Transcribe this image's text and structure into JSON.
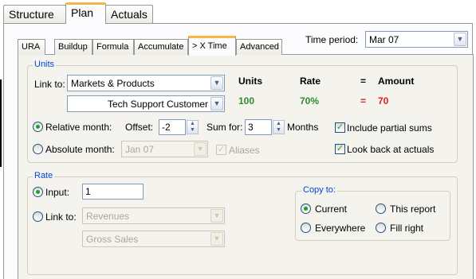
{
  "top_tabs": [
    {
      "label": "Structure"
    },
    {
      "label": "Plan"
    },
    {
      "label": "Actuals"
    }
  ],
  "sub_tabs": [
    {
      "label": "URA"
    },
    {
      "label": "Buildup"
    },
    {
      "label": "Formula"
    },
    {
      "label": "Accumulate"
    },
    {
      "label": "> X Time"
    },
    {
      "label": "Advanced"
    }
  ],
  "time_period": {
    "label": "Time period:",
    "value": "Mar 07"
  },
  "units": {
    "title": "Units",
    "link_to_label": "Link to:",
    "link_to_value": "Markets & Products",
    "sub_value": "Tech Support Customer",
    "headers": {
      "units": "Units",
      "rate": "Rate",
      "equals": "=",
      "amount": "Amount"
    },
    "values": {
      "units": "100",
      "rate": "70%",
      "equals": "=",
      "amount": "70"
    },
    "relative_month_label": "Relative month:",
    "offset_label": "Offset:",
    "offset_value": "-2",
    "sum_for_label": "Sum for:",
    "sum_for_value": "3",
    "months_label": "Months",
    "include_partial_sums": "Include partial sums",
    "absolute_month_label": "Absolute month:",
    "absolute_month_value": "Jan 07",
    "aliases_label": "Aliases",
    "look_back_label": "Look back at actuals"
  },
  "rate": {
    "title": "Rate",
    "input_label": "Input:",
    "input_value": "1",
    "link_to_label": "Link to:",
    "link_value": "Revenues",
    "sub_link_value": "Gross Sales"
  },
  "copy_to": {
    "title": "Copy to:",
    "current": "Current",
    "this_report": "This report",
    "everywhere": "Everywhere",
    "fill_right": "Fill right"
  },
  "colors": {
    "tab_accent": "#f7b64a",
    "group_title": "#0046d5",
    "value_green": "#2e8b2e",
    "value_red": "#e02020"
  }
}
